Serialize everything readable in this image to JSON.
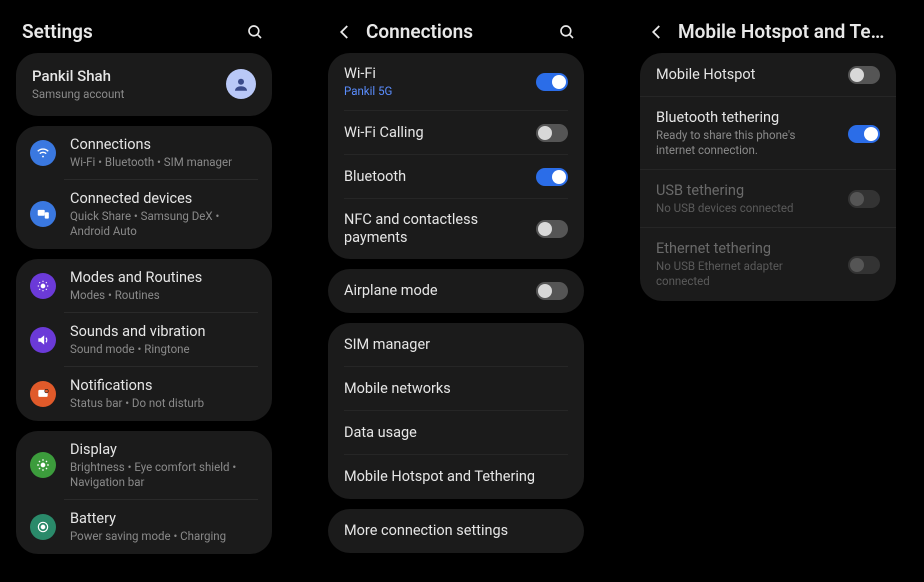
{
  "screen1": {
    "title": "Settings",
    "account": {
      "name": "Pankil Shah",
      "sub": "Samsung account"
    },
    "group1": [
      {
        "icon": "wifi",
        "color": "#3a78e0",
        "title": "Connections",
        "sub": "Wi-Fi  •  Bluetooth  •  SIM manager"
      },
      {
        "icon": "devices",
        "color": "#3a78e0",
        "title": "Connected devices",
        "sub": "Quick Share  •  Samsung DeX  •  Android Auto"
      }
    ],
    "group2": [
      {
        "icon": "modes",
        "color": "#6b3ad8",
        "title": "Modes and Routines",
        "sub": "Modes  •  Routines"
      },
      {
        "icon": "sound",
        "color": "#6b3ad8",
        "title": "Sounds and vibration",
        "sub": "Sound mode  •  Ringtone"
      },
      {
        "icon": "notif",
        "color": "#e05a2a",
        "title": "Notifications",
        "sub": "Status bar  •  Do not disturb"
      }
    ],
    "group3": [
      {
        "icon": "display",
        "color": "#3c9c3c",
        "title": "Display",
        "sub": "Brightness  •  Eye comfort shield  •  Navigation bar"
      },
      {
        "icon": "battery",
        "color": "#2a8a6a",
        "title": "Battery",
        "sub": "Power saving mode  •  Charging"
      }
    ]
  },
  "screen2": {
    "title": "Connections",
    "group1": [
      {
        "title": "Wi-Fi",
        "sub": "Pankil 5G",
        "subBlue": true,
        "toggle": "on"
      },
      {
        "title": "Wi-Fi Calling",
        "toggle": "off"
      },
      {
        "title": "Bluetooth",
        "toggle": "on"
      },
      {
        "title": "NFC and contactless payments",
        "toggle": "off"
      }
    ],
    "group2": [
      {
        "title": "Airplane mode",
        "toggle": "off"
      }
    ],
    "group3": [
      {
        "title": "SIM manager"
      },
      {
        "title": "Mobile networks"
      },
      {
        "title": "Data usage"
      },
      {
        "title": "Mobile Hotspot and Tethering"
      }
    ],
    "group4": [
      {
        "title": "More connection settings"
      }
    ]
  },
  "screen3": {
    "title": "Mobile Hotspot and Tether...",
    "items": [
      {
        "title": "Mobile Hotspot",
        "toggle": "off"
      },
      {
        "title": "Bluetooth tethering",
        "sub": "Ready to share this phone's internet connection.",
        "toggle": "on"
      },
      {
        "title": "USB tethering",
        "sub": "No USB devices connected",
        "toggle": "disabled",
        "dim": true
      },
      {
        "title": "Ethernet tethering",
        "sub": "No USB Ethernet adapter connected",
        "toggle": "disabled",
        "dim": true
      }
    ]
  }
}
